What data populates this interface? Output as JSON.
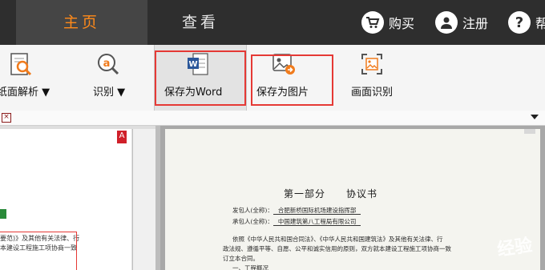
{
  "topbar": {
    "tabs": [
      {
        "label": "主页",
        "active": true
      },
      {
        "label": "查看",
        "active": false
      }
    ],
    "buy_label": "购买",
    "register_label": "注册",
    "help_label": "帮",
    "accent_color": "#ff8a1a"
  },
  "ribbon": {
    "items": [
      {
        "label": "纸面解析 ▼",
        "icon": "magnify-doc-icon"
      },
      {
        "label": "识别 ▼",
        "icon": "ocr-a-icon"
      },
      {
        "label": "保存为Word",
        "icon": "word-icon"
      },
      {
        "label": "保存为图片",
        "icon": "image-export-icon"
      },
      {
        "label": "画面识别",
        "icon": "screen-capture-icon"
      }
    ]
  },
  "left_page": {
    "marker": "A",
    "lines": [
      "要范)》及其他有关法律、行",
      "本建设工程施工项协商一致"
    ]
  },
  "document": {
    "title": "第一部分　　协议书",
    "lines": [
      {
        "label": "发包人(全称)：",
        "value": "合肥新桥国际机场建设指挥部"
      },
      {
        "label": "承包人(全称)：",
        "value": "中国建筑第八工程局有限公司"
      },
      {
        "text": "依照《中华人民共和国合同法》、《中华人民共和国建筑法》及其他有关法律、行"
      },
      {
        "text": "政法规、遵循平等、自愿、公平和诚实信用的原则，双方就本建设工程施工项协商一致"
      },
      {
        "text": "订立本合同。"
      },
      {
        "text": "一、工程概况"
      }
    ],
    "watermark": "经验"
  }
}
